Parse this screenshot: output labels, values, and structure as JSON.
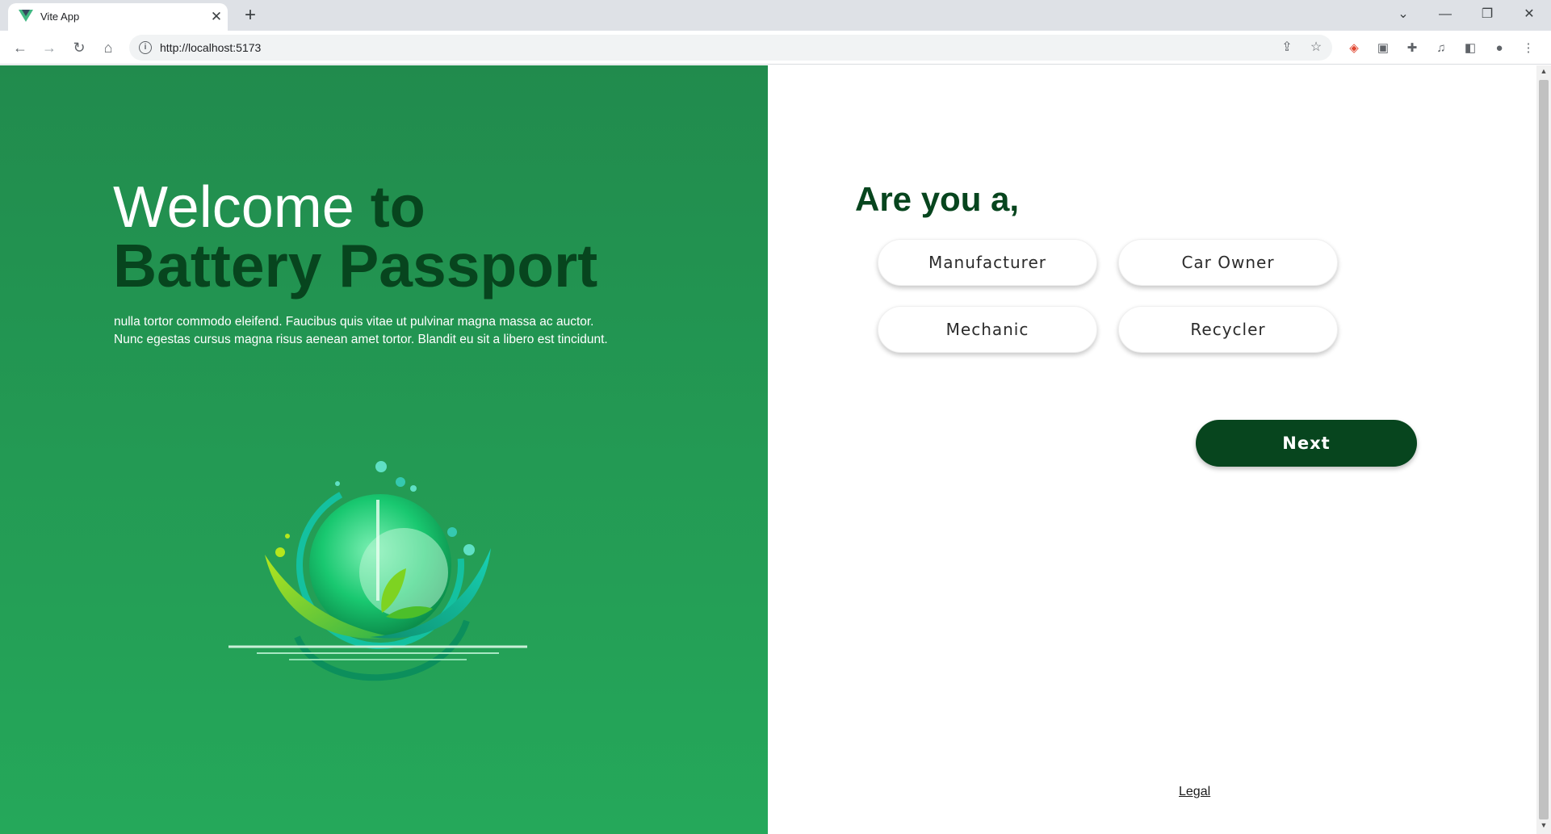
{
  "browser": {
    "tab_title": "Vite App",
    "tab_close": "✕",
    "new_tab": "+",
    "url": "http://localhost:5173",
    "window_controls": {
      "tab_search": "⌄",
      "minimize": "—",
      "restore": "❐",
      "close": "✕"
    },
    "icons": [
      "back-icon",
      "forward-icon",
      "reload-icon",
      "home-icon",
      "info-icon",
      "share-icon",
      "star-icon",
      "extension-icons",
      "puzzle-icon",
      "media-icon",
      "sidepanel-icon",
      "profile-icon",
      "menu-icon"
    ]
  },
  "hero": {
    "welcome": "Welcome",
    "to": "to",
    "brand": "Battery Passport",
    "intro_line1": "nulla tortor commodo eleifend. Faucibus quis vitae ut pulvinar magna massa ac auctor.",
    "intro_line2": "Nunc egestas cursus magna risus aenean amet tortor. Blandit eu sit a libero est tincidunt."
  },
  "form": {
    "question": "Are you a,",
    "roles": [
      "Manufacturer",
      "Car Owner",
      "Mechanic",
      "Recycler"
    ],
    "next_label": "Next",
    "legal_label": "Legal"
  },
  "colors": {
    "accent": "#07451e",
    "panel_green_top": "#218b4d",
    "panel_green_bottom": "#25a85a"
  }
}
